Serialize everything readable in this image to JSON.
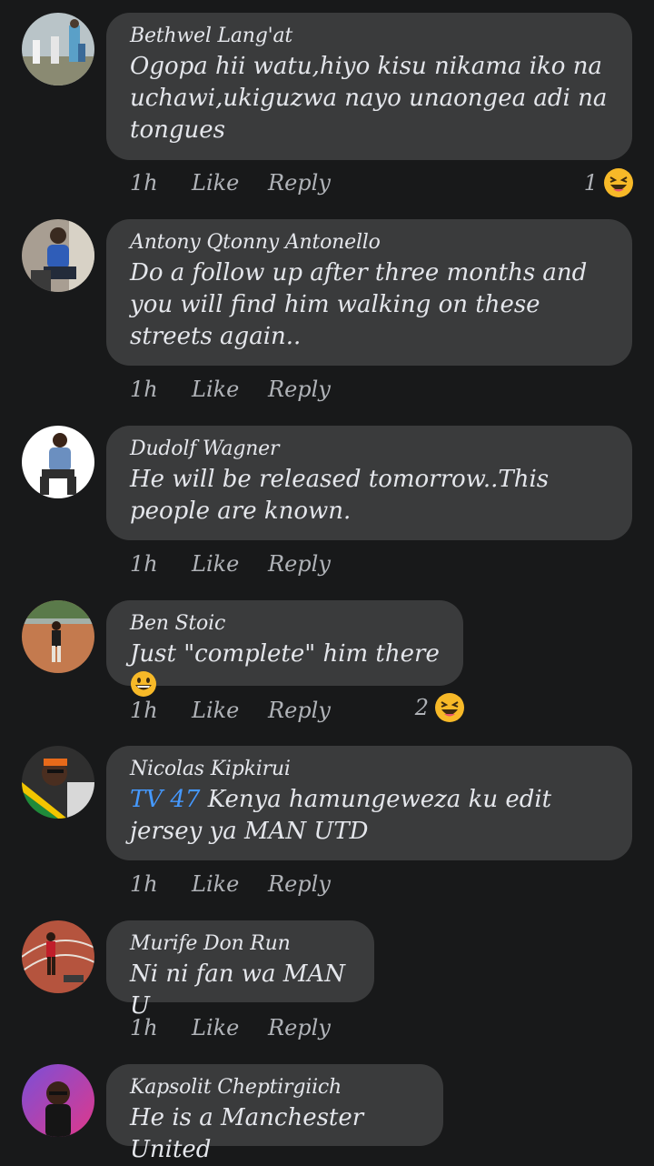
{
  "colors": {
    "background": "#18191a",
    "bubble": "#3a3b3c",
    "text": "#e4e6eb",
    "muted": "#b0b3b8",
    "mention": "#4599ff",
    "emoji": "#f7b928"
  },
  "comments": [
    {
      "author": "Bethwel Lang'at",
      "text": "Ogopa hii watu,hiyo kisu nikama iko na uchawi,ukiguzwa nayo unaongea adi na tongues",
      "time": "1h",
      "like": "Like",
      "reply": "Reply",
      "reaction_count": "1",
      "reaction_icon": "laughing-emoji-icon"
    },
    {
      "author": "Antony Qtonny Antonello",
      "text": "Do a follow up after three months and you will find him walking on these streets again..",
      "time": "1h",
      "like": "Like",
      "reply": "Reply"
    },
    {
      "author": "Dudolf Wagner",
      "text": "He will be released tomorrow..This people are known.",
      "time": "1h",
      "like": "Like",
      "reply": "Reply"
    },
    {
      "author": "Ben Stoic",
      "text": "Just \"complete\" him there",
      "text_emoji": "grinning-emoji-icon",
      "time": "1h",
      "like": "Like",
      "reply": "Reply",
      "reaction_count": "2",
      "reaction_icon": "laughing-emoji-icon"
    },
    {
      "author": "Nicolas Kipkirui",
      "mention": "TV 47",
      "text": " Kenya hamungeweza ku edit jersey ya MAN UTD",
      "time": "1h",
      "like": "Like",
      "reply": "Reply"
    },
    {
      "author": "Murife Don Run",
      "text": "Ni ni fan wa MAN U",
      "time": "1h",
      "like": "Like",
      "reply": "Reply"
    },
    {
      "author": "Kapsolit Cheptirgiich",
      "text": "He is a Manchester United"
    }
  ]
}
